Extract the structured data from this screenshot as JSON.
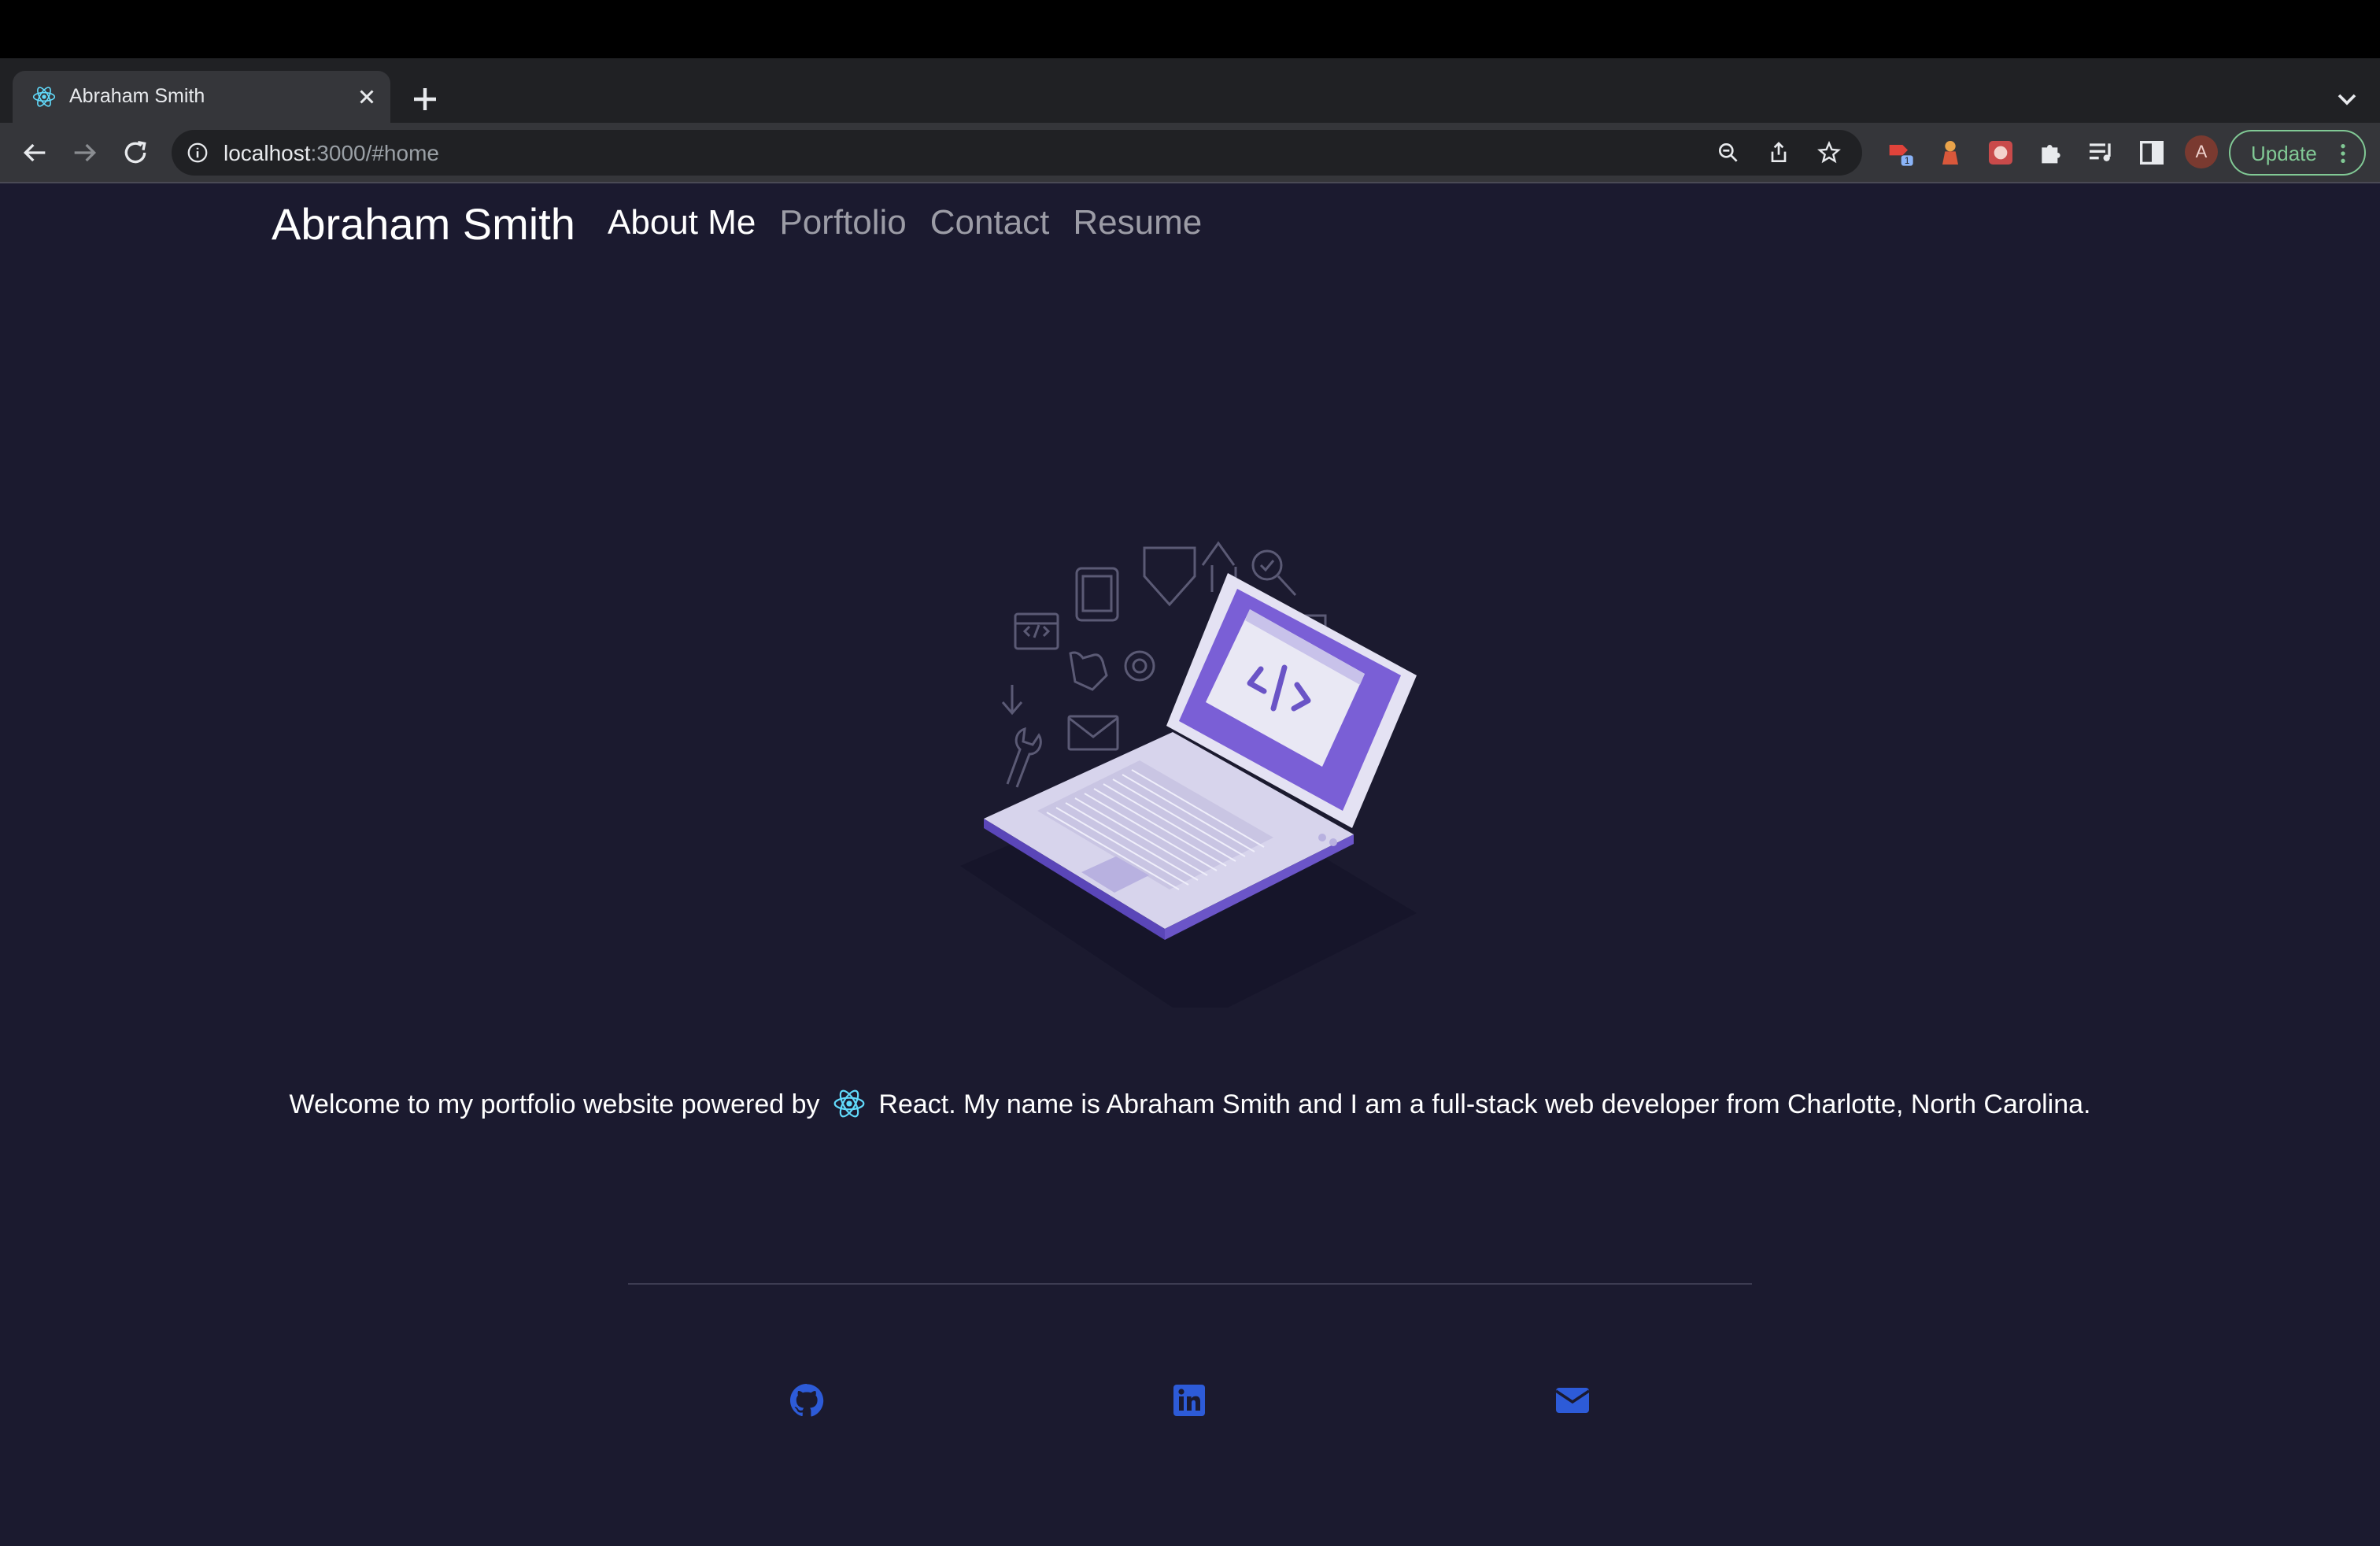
{
  "browser": {
    "tab": {
      "title": "Abraham Smith"
    },
    "url": {
      "host": "localhost",
      "path": ":3000/#home"
    },
    "profile_initial": "A",
    "update_label": "Update",
    "extension_badge": "1"
  },
  "site": {
    "brand": "Abraham Smith",
    "nav": [
      {
        "label": "About Me",
        "active": true
      },
      {
        "label": "Porftolio",
        "active": false
      },
      {
        "label": "Contact",
        "active": false
      },
      {
        "label": "Resume",
        "active": false
      }
    ],
    "welcome_before": "Welcome to my portfolio website powered by",
    "welcome_after": "React. My name is Abraham Smith and I am a full-stack web developer from Charlotte, North Carolina.",
    "social": [
      "github-icon",
      "linkedin-icon",
      "envelope-icon"
    ]
  },
  "colors": {
    "page_bg": "#1b1a2f",
    "accent_purple": "#7a5fd6",
    "social_blue": "#2d5bd8",
    "react_cyan": "#61dafb"
  }
}
